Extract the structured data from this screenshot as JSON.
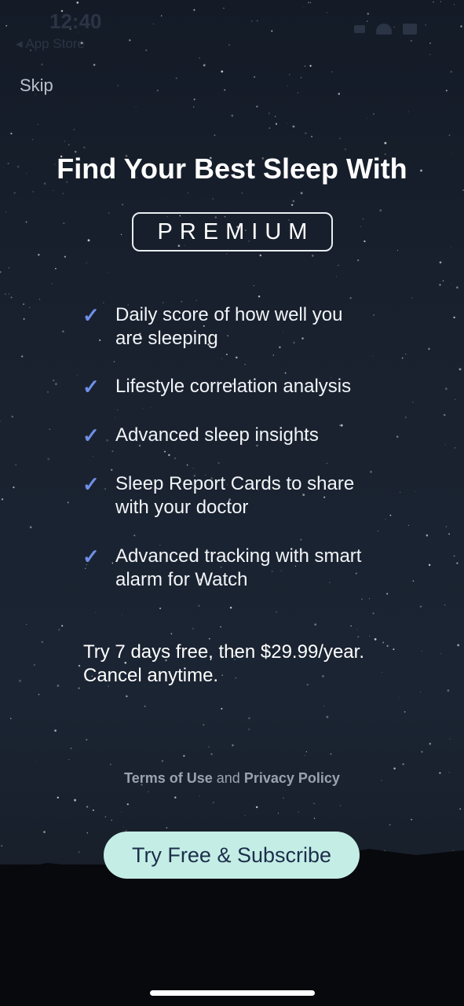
{
  "status_bar": {
    "time": "12:40",
    "back_label": "◂ App Store"
  },
  "nav": {
    "skip_label": "Skip"
  },
  "hero": {
    "headline": "Find Your Best Sleep With",
    "badge": "PREMIUM"
  },
  "features": [
    {
      "check": "✓",
      "lines": [
        "Daily score of how well you",
        "are sleeping"
      ]
    },
    {
      "check": "✓",
      "lines": [
        "Lifestyle correlation analysis"
      ]
    },
    {
      "check": "✓",
      "lines": [
        "Advanced sleep insights"
      ]
    },
    {
      "check": "✓",
      "lines": [
        "Sleep Report Cards to share",
        "with your doctor"
      ]
    },
    {
      "check": "✓",
      "lines": [
        "Advanced tracking with smart",
        "alarm for Watch"
      ]
    }
  ],
  "pricing": {
    "line1": "Try 7 days free, then $29.99/year.",
    "line2": "Cancel anytime."
  },
  "legal": {
    "terms_label": "Terms of Use",
    "and_text": "and",
    "privacy_label": "Privacy Policy"
  },
  "cta": {
    "label": "Try Free & Subscribe"
  },
  "colors": {
    "background": "#1a2230",
    "check_accent": "#6f8fe6",
    "cta_background": "#c4ede6",
    "cta_text": "#1c2f4a"
  },
  "icons": [
    "signal-icon",
    "wifi-icon",
    "battery-icon",
    "checkmark-icon"
  ]
}
